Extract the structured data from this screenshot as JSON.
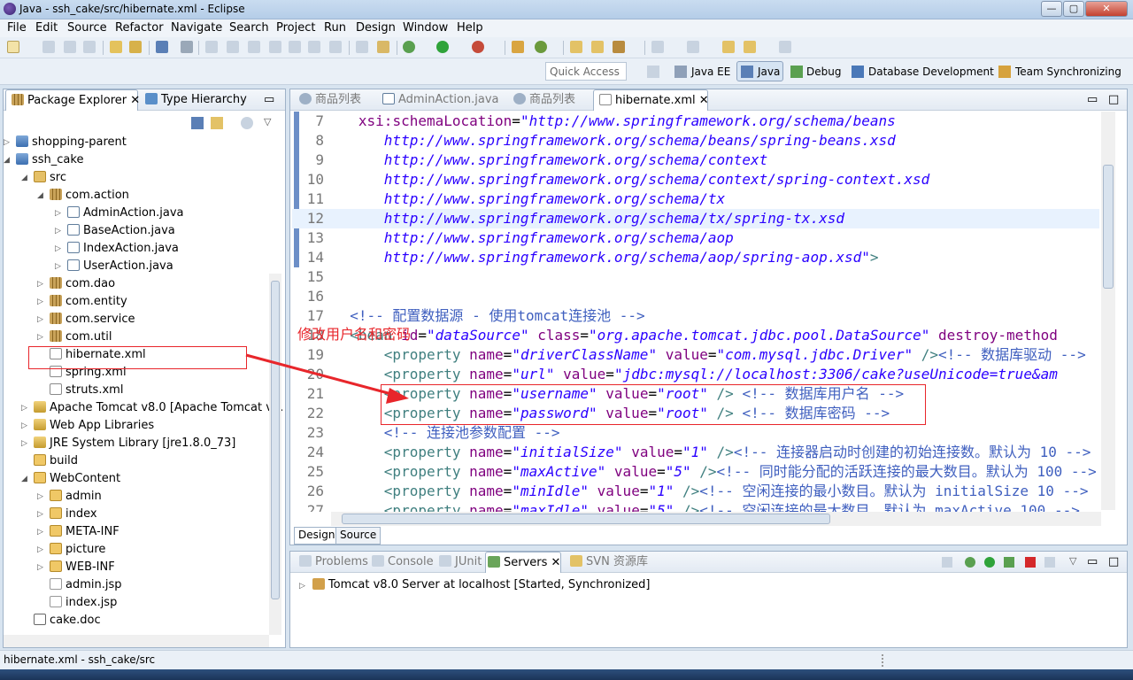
{
  "window": {
    "title": "Java - ssh_cake/src/hibernate.xml - Eclipse",
    "min_glyph": "—",
    "max_glyph": "▢",
    "close_glyph": "✕"
  },
  "menu": [
    "File",
    "Edit",
    "Source",
    "Refactor",
    "Navigate",
    "Search",
    "Project",
    "Run",
    "Design",
    "Window",
    "Help"
  ],
  "perspective_bar": {
    "quick_access_placeholder": "Quick Access",
    "perspectives": [
      "Java EE",
      "Java",
      "Debug",
      "Database Development",
      "Team Synchronizing"
    ]
  },
  "package_explorer": {
    "tabs": [
      "Package Explorer",
      "Type Hierarchy"
    ],
    "tree": [
      {
        "label": "shopping-parent",
        "icon": "project-icon",
        "arrow": "▷"
      },
      {
        "label": "ssh_cake",
        "icon": "project-icon",
        "arrow": "◢"
      },
      {
        "label": "src",
        "icon": "source-folder-icon",
        "arrow": "◢"
      },
      {
        "label": "com.action",
        "icon": "package-icon",
        "arrow": "◢"
      },
      {
        "label": "AdminAction.java",
        "icon": "java-file-icon",
        "arrow": "▷"
      },
      {
        "label": "BaseAction.java",
        "icon": "java-file-icon",
        "arrow": "▷"
      },
      {
        "label": "IndexAction.java",
        "icon": "java-file-icon",
        "arrow": "▷"
      },
      {
        "label": "UserAction.java",
        "icon": "java-file-icon",
        "arrow": "▷"
      },
      {
        "label": "com.dao",
        "icon": "package-icon",
        "arrow": "▷"
      },
      {
        "label": "com.entity",
        "icon": "package-icon",
        "arrow": "▷"
      },
      {
        "label": "com.service",
        "icon": "package-icon",
        "arrow": "▷"
      },
      {
        "label": "com.util",
        "icon": "package-icon",
        "arrow": "▷"
      },
      {
        "label": "hibernate.xml",
        "icon": "xml-file-icon",
        "arrow": ""
      },
      {
        "label": "spring.xml",
        "icon": "xml-file-icon",
        "arrow": ""
      },
      {
        "label": "struts.xml",
        "icon": "xml-file-icon",
        "arrow": ""
      },
      {
        "label": "Apache Tomcat v8.0 [Apache Tomcat v8.",
        "icon": "library-icon",
        "arrow": "▷"
      },
      {
        "label": "Web App Libraries",
        "icon": "library-icon",
        "arrow": "▷"
      },
      {
        "label": "JRE System Library [jre1.8.0_73]",
        "icon": "library-icon",
        "arrow": "▷"
      },
      {
        "label": "build",
        "icon": "folder-icon",
        "arrow": ""
      },
      {
        "label": "WebContent",
        "icon": "folder-icon",
        "arrow": "◢"
      },
      {
        "label": "admin",
        "icon": "folder-icon",
        "arrow": "▷"
      },
      {
        "label": "index",
        "icon": "folder-icon",
        "arrow": "▷"
      },
      {
        "label": "META-INF",
        "icon": "folder-icon",
        "arrow": "▷"
      },
      {
        "label": "picture",
        "icon": "folder-icon",
        "arrow": "▷"
      },
      {
        "label": "WEB-INF",
        "icon": "folder-icon",
        "arrow": "▷"
      },
      {
        "label": "admin.jsp",
        "icon": "jsp-file-icon",
        "arrow": ""
      },
      {
        "label": "index.jsp",
        "icon": "jsp-file-icon",
        "arrow": ""
      },
      {
        "label": "cake.doc",
        "icon": "doc-file-icon",
        "arrow": ""
      }
    ]
  },
  "editor": {
    "tabs": [
      "商品列表",
      "AdminAction.java",
      "商品列表",
      "hibernate.xml"
    ],
    "bottom_tabs": [
      "Design",
      "Source"
    ],
    "lines": [
      {
        "n": "7",
        "html": "   <span class='a'>xsi:schemaLocation</span>=<span class='v'>\"http://www.springframework.org/schema/beans</span>"
      },
      {
        "n": "8",
        "html": "      <span class='v'>http://www.springframework.org/schema/beans/spring-beans.xsd</span>"
      },
      {
        "n": "9",
        "html": "      <span class='v'>http://www.springframework.org/schema/context</span>"
      },
      {
        "n": "10",
        "html": "      <span class='v'>http://www.springframework.org/schema/context/spring-context.xsd</span>"
      },
      {
        "n": "11",
        "html": "      <span class='v'>http://www.springframework.org/schema/tx</span>"
      },
      {
        "n": "12",
        "html": "      <span class='v'>http://www.springframework.org/schema/tx/spring-tx.xsd</span>"
      },
      {
        "n": "13",
        "html": "      <span class='v'>http://www.springframework.org/schema/aop</span>"
      },
      {
        "n": "14",
        "html": "      <span class='v'>http://www.springframework.org/schema/aop/spring-aop.xsd\"</span><span class='t'>&gt;</span>"
      },
      {
        "n": "15",
        "html": ""
      },
      {
        "n": "16",
        "html": ""
      },
      {
        "n": "17",
        "html": "  <span class='c'>&lt;!-- 配置数据源 - 使用tomcat连接池 --&gt;</span>"
      },
      {
        "n": "18",
        "html": "  <span class='t'>&lt;bean</span> <span class='a'>id</span>=<span class='v'>\"dataSource\"</span> <span class='a'>class</span>=<span class='v'>\"org.apache.tomcat.jdbc.pool.DataSource\"</span> <span class='a'>destroy-method</span>"
      },
      {
        "n": "19",
        "html": "      <span class='t'>&lt;property</span> <span class='a'>name</span>=<span class='v'>\"driverClassName\"</span> <span class='a'>value</span>=<span class='v'>\"com.mysql.jdbc.Driver\"</span> <span class='t'>/&gt;</span><span class='c'>&lt;!-- 数据库驱动 --&gt;</span>"
      },
      {
        "n": "20",
        "html": "      <span class='t'>&lt;property</span> <span class='a'>name</span>=<span class='v'>\"url\"</span> <span class='a'>value</span>=<span class='v'>\"jdbc:mysql://localhost:3306/cake?useUnicode=true&amp;am</span>"
      },
      {
        "n": "21",
        "html": "      <span class='t'>&lt;property</span> <span class='a'>name</span>=<span class='v'>\"username\"</span> <span class='a'>value</span>=<span class='v'>\"root\"</span> <span class='t'>/&gt;</span> <span class='c'>&lt;!-- 数据库用户名 --&gt;</span>"
      },
      {
        "n": "22",
        "html": "      <span class='t'>&lt;property</span> <span class='a'>name</span>=<span class='v'>\"password\"</span> <span class='a'>value</span>=<span class='v'>\"root\"</span> <span class='t'>/&gt;</span> <span class='c'>&lt;!-- 数据库密码 --&gt;</span>"
      },
      {
        "n": "23",
        "html": "      <span class='c'>&lt;!-- 连接池参数配置 --&gt;</span>"
      },
      {
        "n": "24",
        "html": "      <span class='t'>&lt;property</span> <span class='a'>name</span>=<span class='v'>\"initialSize\"</span> <span class='a'>value</span>=<span class='v'>\"1\"</span> <span class='t'>/&gt;</span><span class='c'>&lt;!-- 连接器启动时创建的初始连接数。默认为 10 --&gt;</span>"
      },
      {
        "n": "25",
        "html": "      <span class='t'>&lt;property</span> <span class='a'>name</span>=<span class='v'>\"maxActive\"</span> <span class='a'>value</span>=<span class='v'>\"5\"</span> <span class='t'>/&gt;</span><span class='c'>&lt;!-- 同时能分配的活跃连接的最大数目。默认为 100 --&gt;</span>"
      },
      {
        "n": "26",
        "html": "      <span class='t'>&lt;property</span> <span class='a'>name</span>=<span class='v'>\"minIdle\"</span> <span class='a'>value</span>=<span class='v'>\"1\"</span> <span class='t'>/&gt;</span><span class='c'>&lt;!-- 空闲连接的最小数目。默认为 initialSize 10 --&gt;</span>"
      },
      {
        "n": "27",
        "html": "      <span class='t'>&lt;property</span> <span class='a'>name</span>=<span class='v'>\"maxIdle\"</span> <span class='a'>value</span>=<span class='v'>\"5\"</span> <span class='t'>/&gt;</span><span class='c'>&lt;!-- 空闲连接的最大数目。默认为 maxActive 100 --&gt;</span>"
      }
    ]
  },
  "servers_view": {
    "tabs": [
      "Problems",
      "Console",
      "JUnit",
      "Servers",
      "SVN 资源库"
    ],
    "server_entry": "Tomcat v8.0 Server at localhost  [Started, Synchronized]"
  },
  "annotation": {
    "text": "修改用户名和密码",
    "color": "#e8262b"
  },
  "status_bar": {
    "text": "hibernate.xml - ssh_cake/src"
  },
  "colors": {
    "xml_tag": "#3f7f7f",
    "xml_attr": "#7f007f",
    "xml_value": "#2a00ff",
    "xml_comment": "#3f5fbf",
    "annotation_red": "#e8262b"
  }
}
